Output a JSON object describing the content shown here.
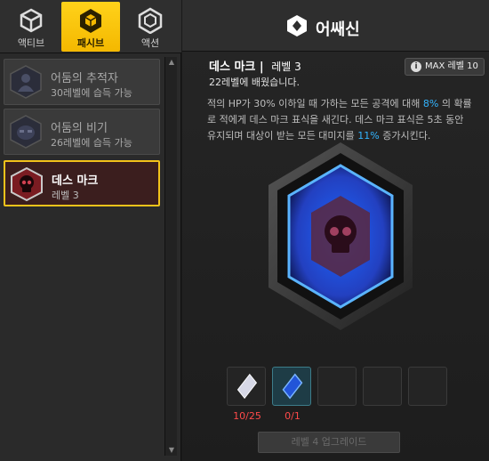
{
  "tabs": [
    {
      "label": "액티브",
      "icon": "cube-outline-icon",
      "active": false
    },
    {
      "label": "패시브",
      "icon": "cube-hex-icon",
      "active": true
    },
    {
      "label": "액션",
      "icon": "hexagon-ring-icon",
      "active": false
    }
  ],
  "skill_list": [
    {
      "name": "어둠의 추적자",
      "sub": "30레벨에 습득 가능",
      "icon": "shadow-figure-icon",
      "locked": true
    },
    {
      "name": "어둠의 비기",
      "sub": "26레벨에 습득 가능",
      "icon": "shadow-mask-icon",
      "locked": true
    },
    {
      "name": "데스 마크",
      "sub": "레벨 3",
      "icon": "skull-icon",
      "selected": true
    }
  ],
  "header": {
    "title": "어쌔신",
    "icon": "assassin-class-icon"
  },
  "detail": {
    "skill_name": "데스 마크",
    "separator": "|",
    "level": "레벨 3",
    "learned": "22레벨에 배웠습니다.",
    "max_level": "MAX 레벨 10",
    "desc_1": "적의 HP가 30% 이하일 때 가하는 모든 공격에 대해 ",
    "desc_hl_1": "8%",
    "desc_2": " 의 확률로 적에게 데스 마크 표식을 새긴다. 데스 마크 표식은 5초 동안 유지되며 대상이 받는 모든 대미지를 ",
    "desc_hl_2": "11%",
    "desc_3": " 증가시킨다."
  },
  "materials": [
    {
      "icon": "silver-crystal-icon",
      "count": "10/25"
    },
    {
      "icon": "blue-crystal-icon",
      "count": "0/1"
    },
    {
      "icon": "",
      "count": ""
    },
    {
      "icon": "",
      "count": ""
    },
    {
      "icon": "",
      "count": ""
    }
  ],
  "upgrade_button": "레벨 4 업그레이드",
  "colors": {
    "accent": "#f4b800",
    "highlight": "#33b4ff",
    "warning": "#ff4a4a"
  }
}
